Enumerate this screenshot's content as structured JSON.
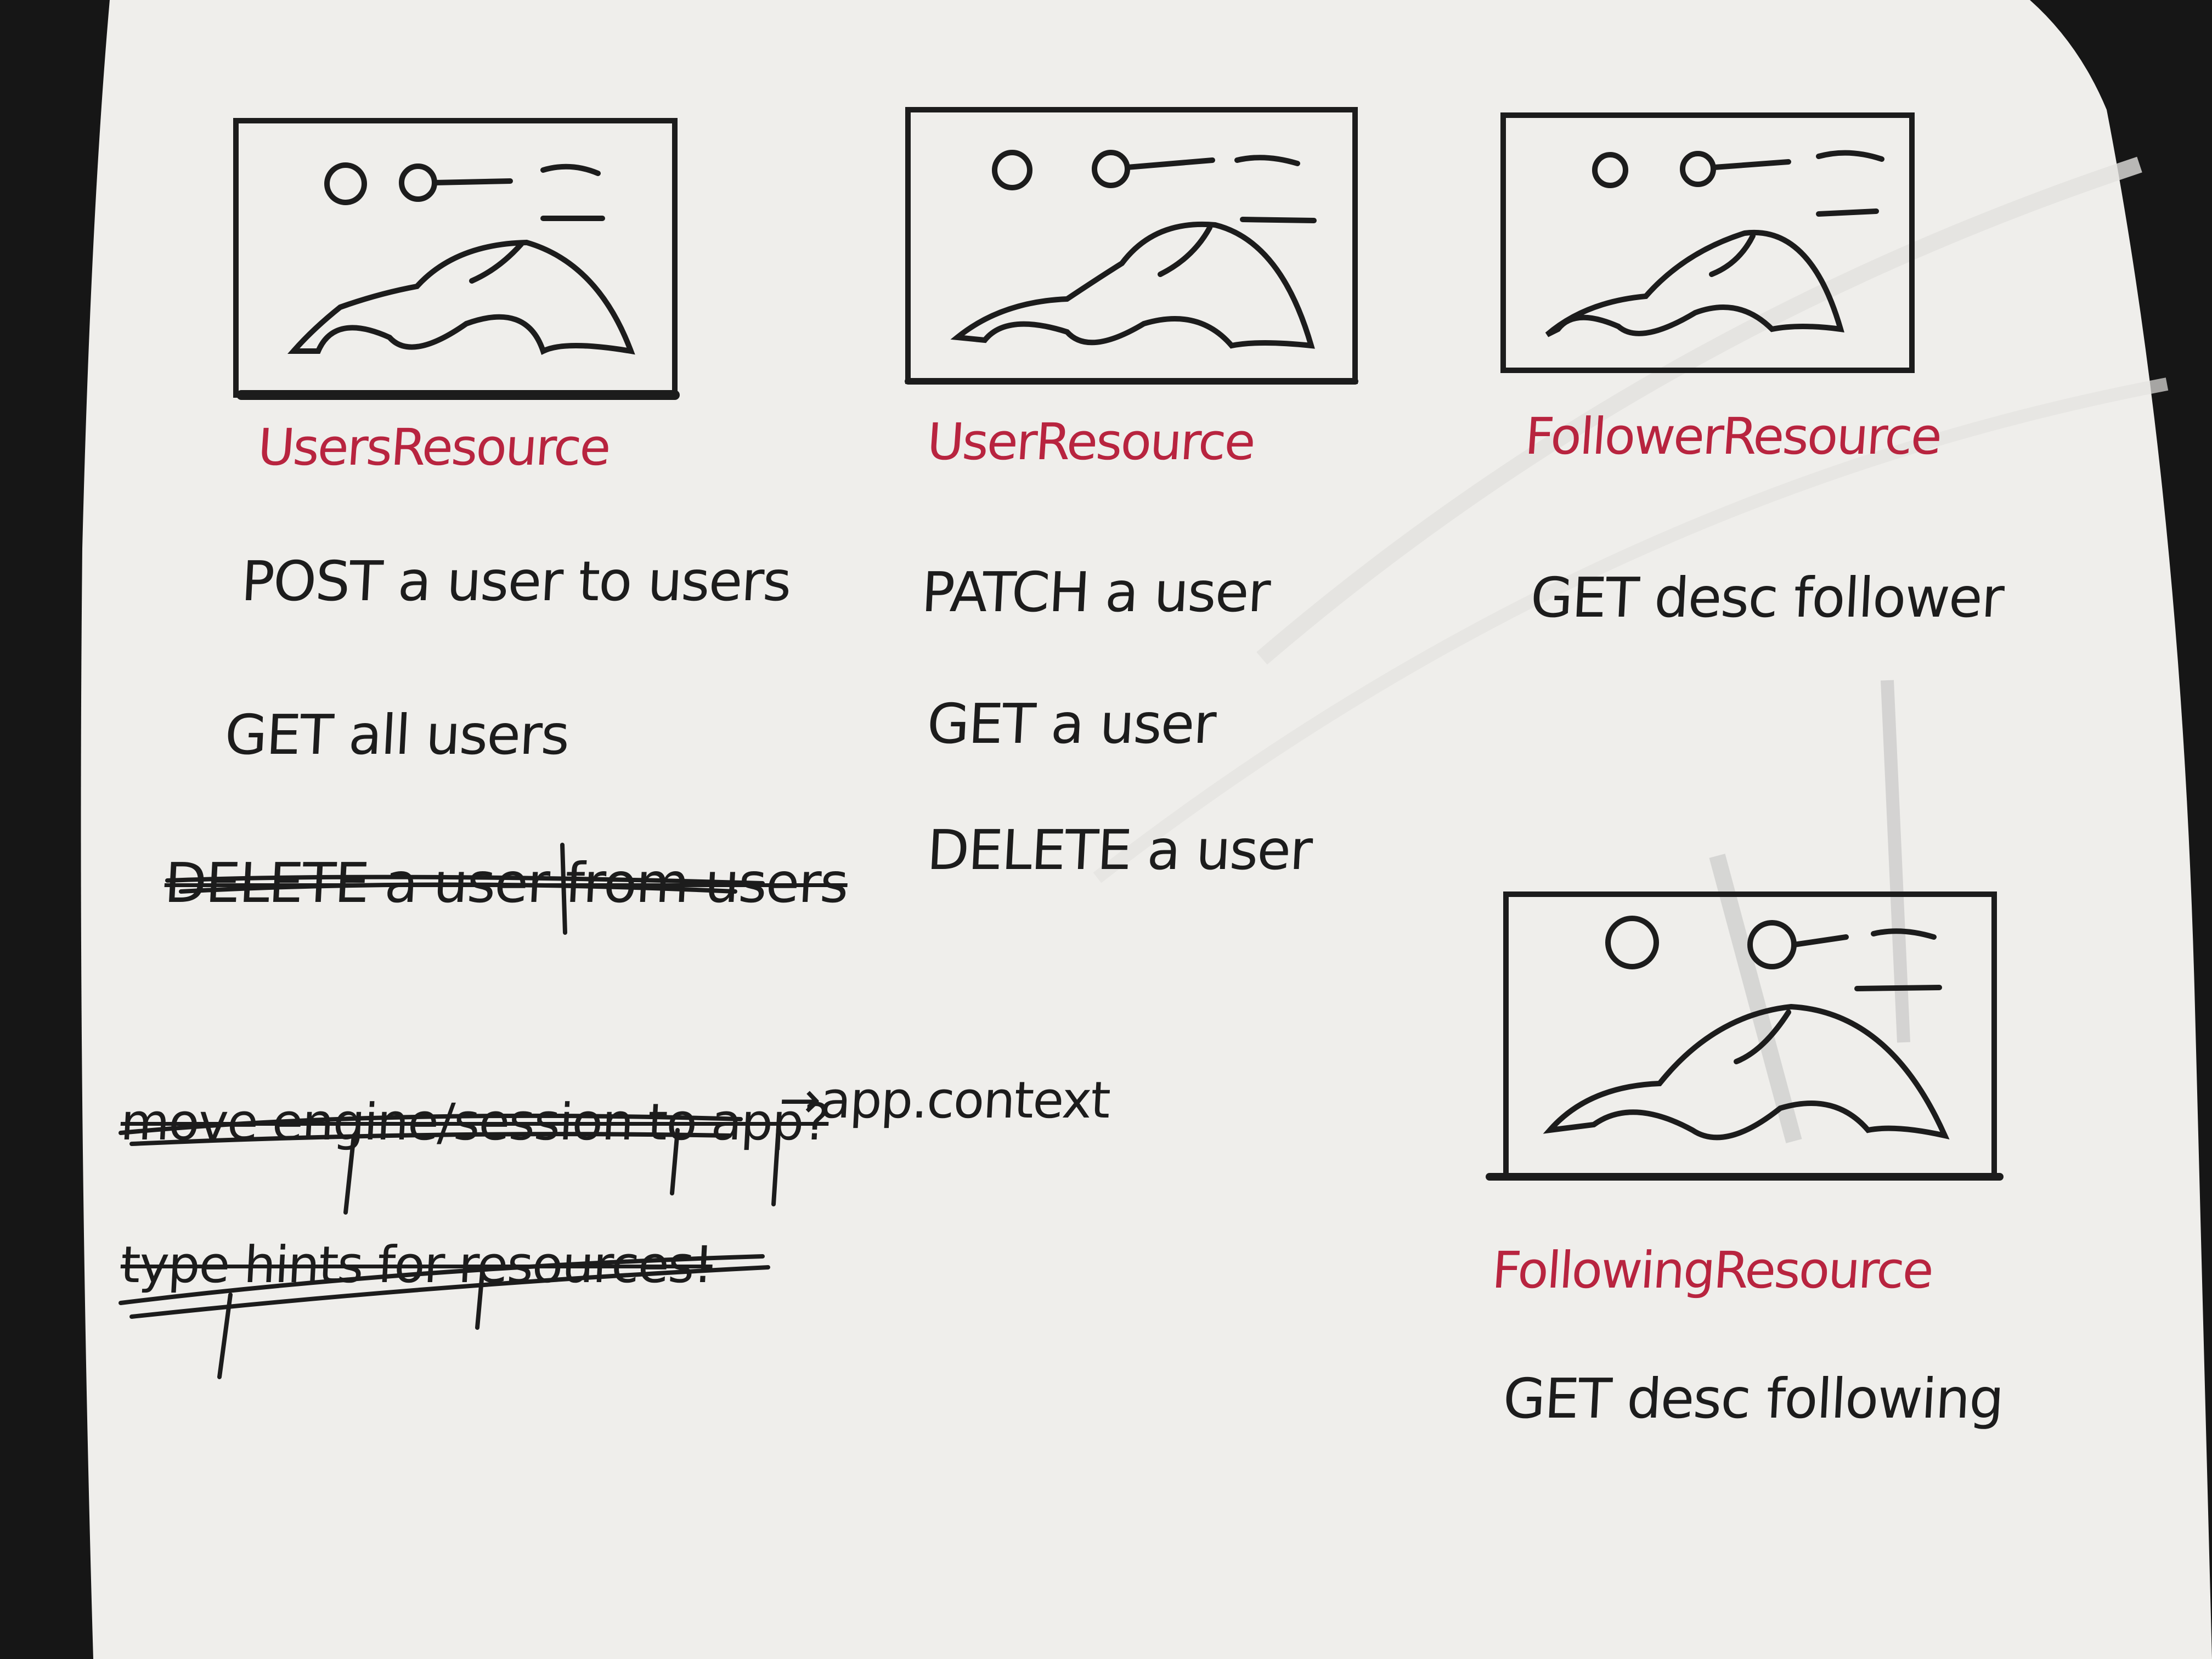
{
  "columns": [
    {
      "heading": "UsersResource",
      "tasks": [
        {
          "text": "POST a user to users",
          "done": false
        },
        {
          "text": "GET all users",
          "done": false
        },
        {
          "text": "DELETE a user from users",
          "done": true
        }
      ]
    },
    {
      "heading": "UserResource",
      "tasks": [
        {
          "text": "PATCH a user",
          "done": false
        },
        {
          "text": "GET a user",
          "done": false
        },
        {
          "text": "DELETE a user",
          "done": false
        }
      ]
    },
    {
      "heading": "FollowerResource",
      "tasks": [
        {
          "text": "GET desc follower",
          "done": false
        }
      ]
    },
    {
      "heading": "FollowingResource",
      "tasks": [
        {
          "text": "GET desc following",
          "done": false
        }
      ]
    }
  ],
  "notes": {
    "move_engine": "move engine/session to app?",
    "app_context": "→app.context",
    "type_hints": "type hints for resources!"
  },
  "colors": {
    "paper": "#efeeeb",
    "ink": "#1c1c1c",
    "heading_ink": "#b8243f",
    "background": "#161616"
  },
  "sketch_icon": "image-placeholder-icon"
}
